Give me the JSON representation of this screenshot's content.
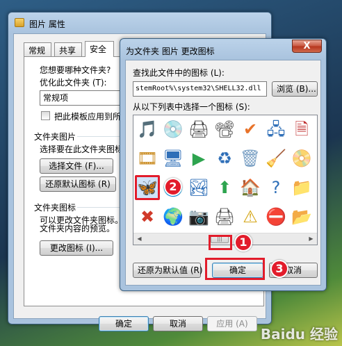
{
  "props_window": {
    "title": "图片 属性",
    "tabs": [
      "常规",
      "共享",
      "安全"
    ],
    "q_label": "您想要哪种文件夹?",
    "optimize_label": "优化此文件夹 (T):",
    "optimize_value": "常规项",
    "apply_template_label": "把此模板应用到所有",
    "folder_pictures_header": "文件夹图片",
    "folder_pictures_desc": "选择要在此文件夹图标",
    "choose_file_button": "选择文件 (F)...",
    "restore_default_pic_button": "还原默认图标 (R)",
    "folder_icon_header": "文件夹图标",
    "folder_icon_desc_1": "可以更改文件夹图标。",
    "folder_icon_desc_2": "文件夹内容的预览。",
    "change_icon_button": "更改图标 (I)...",
    "ok_button": "确定",
    "cancel_button": "取消",
    "apply_button": "应用 (A)"
  },
  "dialog": {
    "title": "为文件夹 图片 更改图标",
    "close_symbol": "X",
    "find_label": "查找此文件中的图标 (L):",
    "path_value": "stemRoot%\\system32\\SHELL32.dll",
    "browse_button": "浏览 (B)...",
    "select_label": "从以下列表中选择一个图标 (S):",
    "restore_button": "还原为默认值 (R)",
    "ok_button": "确定",
    "cancel_button": "取消"
  },
  "icons": [
    {
      "name": "folder-music-icon",
      "glyph": "🎵",
      "color": "#c98a1d"
    },
    {
      "name": "cd-arrow-icon",
      "glyph": "💿",
      "color": "#3a9a3a"
    },
    {
      "name": "printer-icon",
      "glyph": "🖨",
      "color": "#4a4a4a"
    },
    {
      "name": "projector-screen-icon",
      "glyph": "📽",
      "color": "#555555"
    },
    {
      "name": "checkmark-icon",
      "glyph": "✔",
      "color": "#e8732a"
    },
    {
      "name": "network-computers-icon",
      "glyph": "🖧",
      "color": "#2f6fb8"
    },
    {
      "name": "document-x-icon",
      "glyph": "🗎",
      "color": "#c03030"
    },
    {
      "name": "folder-video-icon",
      "glyph": "🎞",
      "color": "#c98a1d"
    },
    {
      "name": "monitor-icon",
      "glyph": "🖥",
      "color": "#2f6fb8"
    },
    {
      "name": "play-button-icon",
      "glyph": "▶",
      "color": "#2ea44f"
    },
    {
      "name": "recycle-media-icon",
      "glyph": "♻",
      "color": "#2f6fb8"
    },
    {
      "name": "recycle-bin-icon",
      "glyph": "🗑",
      "color": "#7aa0c4"
    },
    {
      "name": "cleanup-icon",
      "glyph": "🧹",
      "color": "#3a9a3a"
    },
    {
      "name": "dvd-disc-icon",
      "glyph": "📀",
      "color": "#b0b0b0"
    },
    {
      "name": "msn-butterfly-icon",
      "glyph": "🦋",
      "color": "#e8732a"
    },
    {
      "name": "globe-icon",
      "glyph": "🌐",
      "color": "#2f6fb8"
    },
    {
      "name": "landscape-picture-icon",
      "glyph": "🏞",
      "color": "#2f6fb8"
    },
    {
      "name": "up-arrow-icon",
      "glyph": "⬆",
      "color": "#2ea44f"
    },
    {
      "name": "home-icon",
      "glyph": "🏠",
      "color": "#c0392b"
    },
    {
      "name": "help-icon",
      "glyph": "?",
      "color": "#2f6fb8"
    },
    {
      "name": "folder-yellow-icon",
      "glyph": "📁",
      "color": "#e3b54a"
    },
    {
      "name": "x-mark-icon",
      "glyph": "✖",
      "color": "#d03a2a"
    },
    {
      "name": "network-globe-icon",
      "glyph": "🌍",
      "color": "#2f6fb8"
    },
    {
      "name": "camera-icon",
      "glyph": "📷",
      "color": "#555555"
    },
    {
      "name": "scanner-icon",
      "glyph": "🖨",
      "color": "#555555"
    },
    {
      "name": "warning-icon",
      "glyph": "⚠",
      "color": "#d4a514"
    },
    {
      "name": "no-entry-disc-icon",
      "glyph": "⛔",
      "color": "#d03a2a"
    },
    {
      "name": "folder-light-icon",
      "glyph": "📂",
      "color": "#e3b54a"
    }
  ],
  "markers": [
    "1",
    "2",
    "3"
  ],
  "accent_color": "#e21c2b",
  "watermark": "Baidu 经验"
}
